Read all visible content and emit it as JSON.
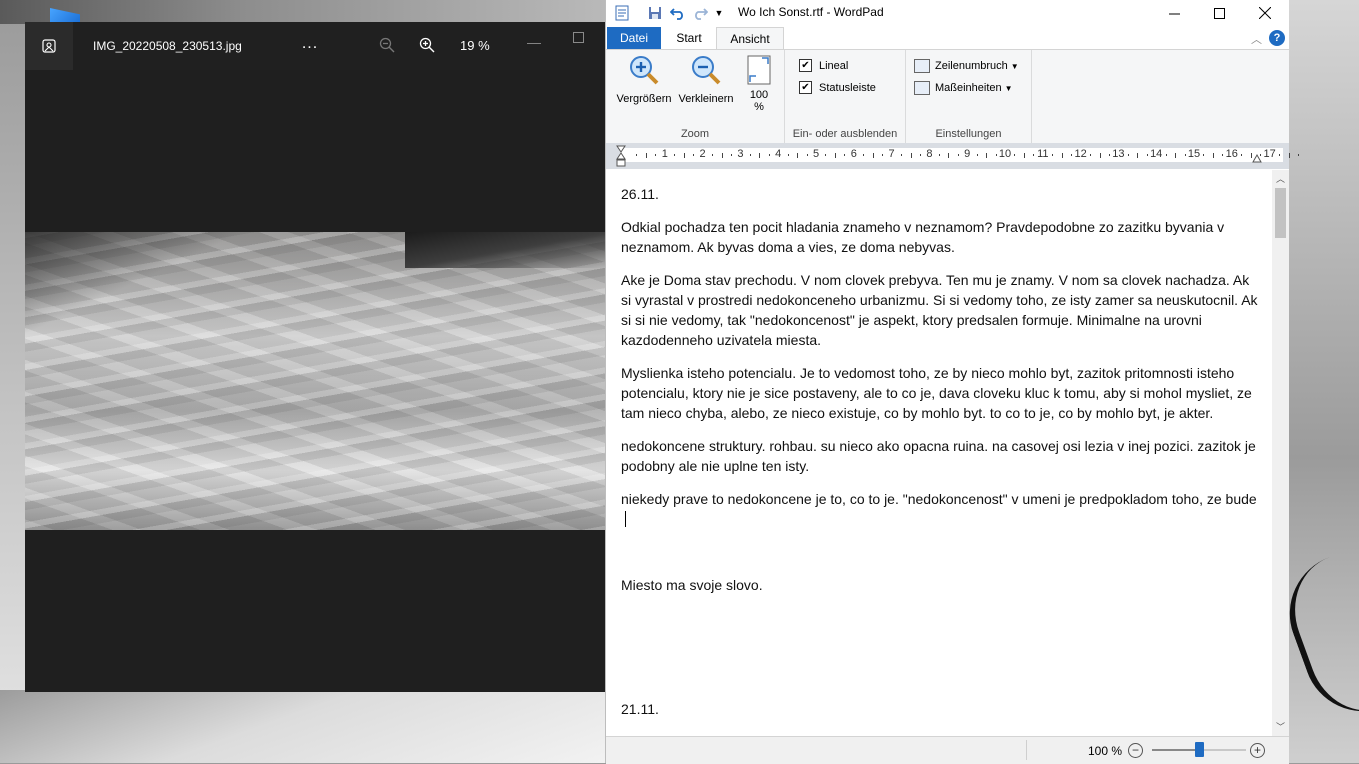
{
  "photos": {
    "file_name": "IMG_20220508_230513.jpg",
    "more_label": "...",
    "zoom_value": "19 %",
    "min_label": "—"
  },
  "wordpad": {
    "title": "Wo Ich Sonst.rtf - WordPad",
    "tabs": {
      "file": "Datei",
      "start": "Start",
      "view": "Ansicht"
    },
    "help_label": "?",
    "ribbon": {
      "zoom": {
        "zoom_in": "Vergrößern",
        "zoom_out": "Verkleinern",
        "hundred_line1": "100",
        "hundred_line2": "%",
        "group_label": "Zoom"
      },
      "show_hide": {
        "ruler": "Lineal",
        "ruler_checked": true,
        "statusbar": "Statusleiste",
        "statusbar_checked": true,
        "group_label": "Ein- oder ausblenden"
      },
      "settings": {
        "word_wrap": "Zeilenumbruch",
        "units": "Maßeinheiten",
        "group_label": "Einstellungen"
      }
    },
    "ruler_numbers": [
      "1",
      "2",
      "3",
      "4",
      "5",
      "6",
      "7",
      "8",
      "9",
      "10",
      "11",
      "12",
      "13",
      "14",
      "15",
      "16",
      "17"
    ],
    "document": {
      "p1": "26.11.",
      "p2": "Odkial pochadza ten pocit hladania znameho v neznamom? Pravdepodobne zo zazitku byvania v neznamom. Ak byvas doma a vies, ze doma nebyvas.",
      "p3": "Ake je Doma stav prechodu. V nom clovek prebyva. Ten mu je znamy. V nom sa clovek nachadza. Ak si vyrastal v prostredi nedokonceneho urbanizmu. Si si vedomy toho, ze isty zamer sa neuskutocnil. Ak si si nie vedomy, tak \"nedokoncenost\" je aspekt, ktory predsalen formuje. Minimalne na urovni kazdodenneho uzivatela miesta.",
      "p4": "Myslienka isteho potencialu. Je to vedomost toho, ze by nieco mohlo byt, zazitok pritomnosti isteho potencialu, ktory nie je sice postaveny, ale to co je, dava cloveku kluc k tomu, aby si mohol mysliet, ze tam nieco chyba, alebo, ze nieco existuje, co by mohlo byt. to co to je, co by mohlo byt, je akter.",
      "p5": "nedokoncene struktury. rohbau. su nieco ako opacna ruina. na casovej osi lezia v inej pozici. zazitok je podobny ale nie uplne ten isty.",
      "p6": "niekedy prave to nedokoncene je to, co to je. \"nedokoncenost\" v umeni je predpokladom toho, ze bude",
      "p7": "Miesto ma svoje slovo.",
      "p8": "21.11."
    },
    "status": {
      "zoom_value": "100 %",
      "zoom_minus": "−",
      "zoom_plus": "+",
      "zoom_level": 0.5
    }
  }
}
